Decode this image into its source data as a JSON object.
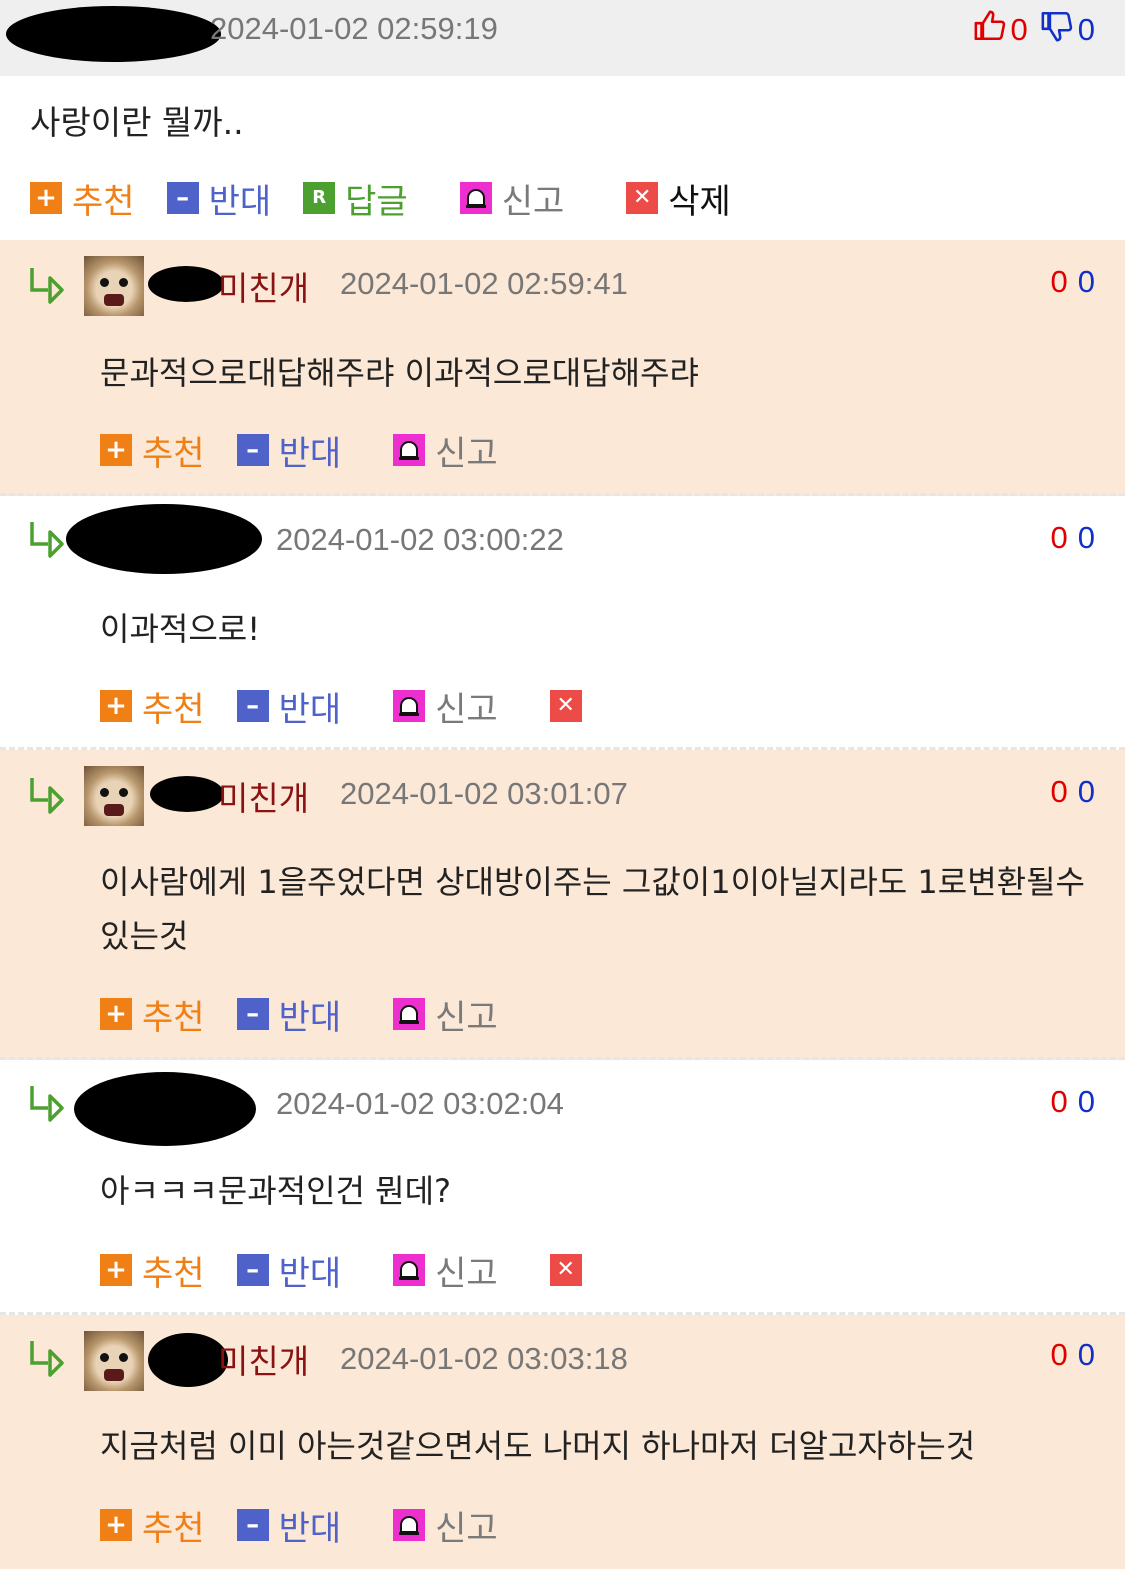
{
  "post": {
    "timestamp": "2024-01-02 02:59:19",
    "upvotes": "0",
    "downvotes": "0",
    "body": "사랑이란 뭘까..",
    "actions": {
      "recommend": "추천",
      "oppose": "반대",
      "reply": "답글",
      "report": "신고",
      "delete": "삭제"
    }
  },
  "comment_actions": {
    "recommend": "추천",
    "oppose": "반대",
    "report": "신고"
  },
  "comments": [
    {
      "nickname": "미친개",
      "timestamp": "2024-01-02 02:59:41",
      "up": "0",
      "down": "0",
      "body": "문과적으로대답해주랴 이과적으로대답해주랴"
    },
    {
      "nickname": "",
      "timestamp": "2024-01-02 03:00:22",
      "up": "0",
      "down": "0",
      "body": "이과적으로!"
    },
    {
      "nickname": "미친개",
      "timestamp": "2024-01-02 03:01:07",
      "up": "0",
      "down": "0",
      "body": "이사람에게 1을주었다면 상대방이주는 그값이1이아닐지라도 1로변환될수있는것"
    },
    {
      "nickname": "",
      "timestamp": "2024-01-02 03:02:04",
      "up": "0",
      "down": "0",
      "body": "아ㅋㅋㅋ문과적인건 뭔데?"
    },
    {
      "nickname": "미친개",
      "timestamp": "2024-01-02 03:03:18",
      "up": "0",
      "down": "0",
      "body": "지금처럼 이미 아는것같으면서도 나머지 하나마저 더알고자하는것"
    }
  ]
}
